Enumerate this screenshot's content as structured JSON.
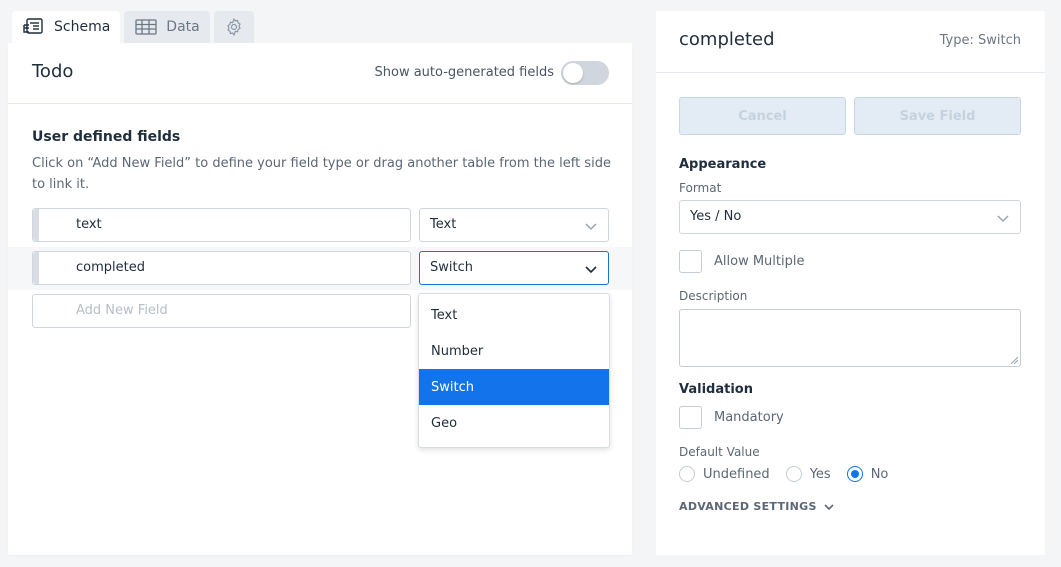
{
  "tabs": [
    {
      "label": "Schema",
      "icon": "schema-icon",
      "active": true
    },
    {
      "label": "Data",
      "icon": "table-icon",
      "active": false
    },
    {
      "label": "",
      "icon": "gear-icon",
      "active": false
    }
  ],
  "table": {
    "title": "Todo",
    "auto_generated_label": "Show auto-generated fields",
    "auto_generated_on": false
  },
  "fields_section": {
    "title": "User defined fields",
    "description": "Click on “Add New Field” to define your field type or drag another table from the left side to link it."
  },
  "fields": [
    {
      "name": "text",
      "type": "Text"
    },
    {
      "name": "completed",
      "type": "Switch"
    }
  ],
  "new_field": {
    "placeholder": "Add New Field"
  },
  "type_dropdown": {
    "options": [
      "Text",
      "Number",
      "Switch",
      "Geo"
    ],
    "selected": "Switch"
  },
  "detail": {
    "field_name": "completed",
    "type_label": "Type: Switch",
    "cancel_label": "Cancel",
    "save_label": "Save Field",
    "appearance_title": "Appearance",
    "format_label": "Format",
    "format_value": "Yes / No",
    "allow_multiple_label": "Allow Multiple",
    "description_label": "Description",
    "description_value": "",
    "validation_title": "Validation",
    "mandatory_label": "Mandatory",
    "default_value_label": "Default Value",
    "default_options": [
      "Undefined",
      "Yes",
      "No"
    ],
    "default_selected": "No",
    "advanced_label": "ADVANCED SETTINGS"
  },
  "colors": {
    "accent": "#1273eb",
    "background": "#f3f5f7",
    "disabled_button": "#e3ecf4"
  }
}
